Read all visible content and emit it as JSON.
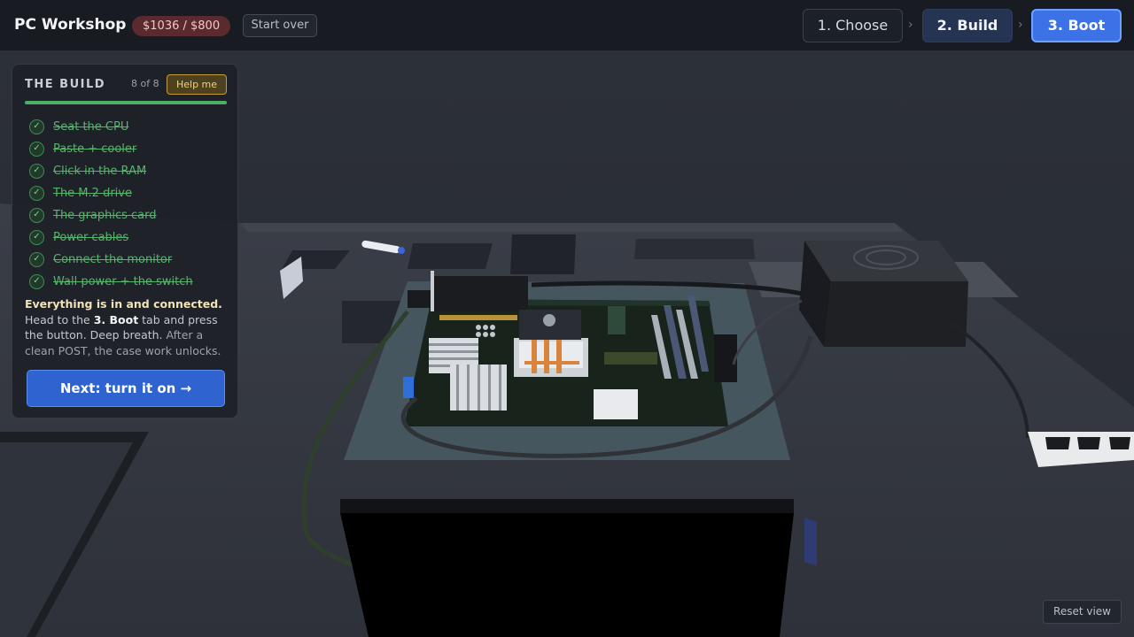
{
  "header": {
    "app_title": "PC Workshop",
    "budget": "$1036 / $800",
    "start_over": "Start over",
    "steps": [
      {
        "label": "1. Choose",
        "state": "done"
      },
      {
        "label": "2. Build",
        "state": "current"
      },
      {
        "label": "3. Boot",
        "state": "active"
      }
    ],
    "separator": "›"
  },
  "panel": {
    "title": "THE BUILD",
    "count": "8 of 8",
    "help": "Help me",
    "progress": 1.0,
    "items": [
      {
        "label": "Seat the CPU",
        "done": true
      },
      {
        "label": "Paste + cooler",
        "done": true
      },
      {
        "label": "Click in the RAM",
        "done": true
      },
      {
        "label": "The M.2 drive",
        "done": true
      },
      {
        "label": "The graphics card",
        "done": true
      },
      {
        "label": "Power cables",
        "done": true
      },
      {
        "label": "Connect the monitor",
        "done": true
      },
      {
        "label": "Wall power + the switch",
        "done": true
      }
    ],
    "check_glyph": "✓",
    "info": {
      "lead": "Everything is in and connected.",
      "part1": "Head to the",
      "highlight": "3. Boot",
      "part2": "tab and press the button. Deep breath.",
      "part3": "After a clean POST, the case work unlocks."
    },
    "next": "Next: turn it on →"
  },
  "reset_view": "Reset view",
  "colors": {
    "accent": "#3d72e6",
    "success": "#4caf68",
    "warning": "#c59a3a",
    "over_budget": "#5a2a2e"
  },
  "icons": [
    "check-icon",
    "chevron-right-icon"
  ]
}
